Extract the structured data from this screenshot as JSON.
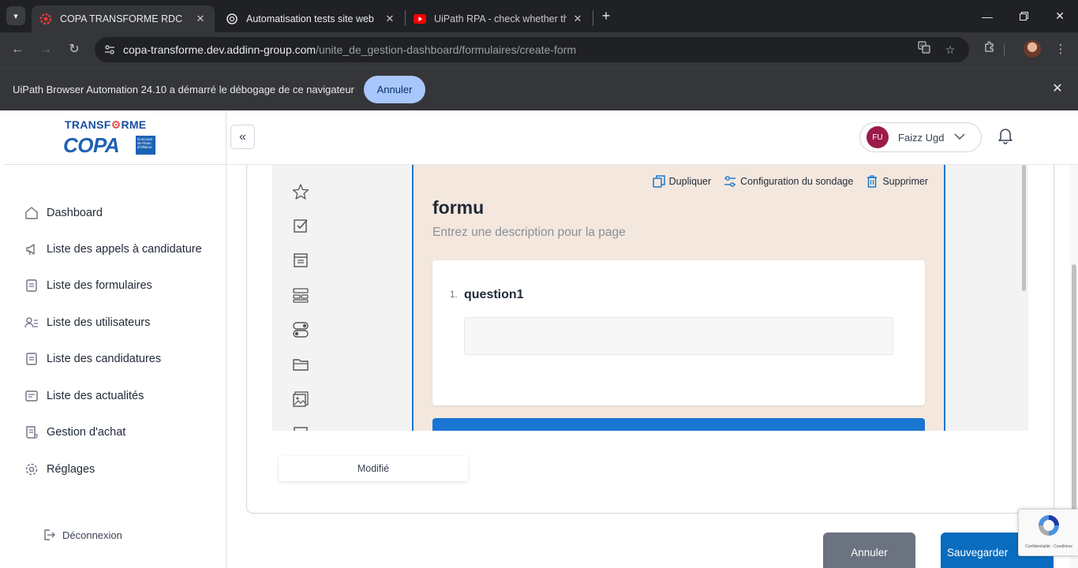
{
  "browser": {
    "tabs": [
      {
        "title": "COPA TRANSFORME RDC",
        "active": true
      },
      {
        "title": "Automatisation tests site web",
        "active": false
      },
      {
        "title": "UiPath RPA - check whether the",
        "active": false
      }
    ],
    "url_host": "copa-transforme.dev.addinn-group.com",
    "url_path": "/unite_de_gestion-dashboard/formulaires/create-form",
    "infobar_message": "UiPath Browser Automation 24.10 a démarré le débogage de ce navigateur",
    "infobar_button": "Annuler"
  },
  "logo": {
    "line1_a": "TRANSF",
    "line1_gear": "⚙",
    "line1_b": "RME",
    "line2": "COPA",
    "tagline": "Concours de Plans d'Affaires"
  },
  "sidebar": {
    "items": [
      {
        "label": "Dashboard",
        "icon": "home-icon"
      },
      {
        "label": "Liste des appels à candidature",
        "icon": "megaphone-icon"
      },
      {
        "label": "Liste des formulaires",
        "icon": "document-icon"
      },
      {
        "label": "Liste des utilisateurs",
        "icon": "users-icon"
      },
      {
        "label": "Liste des candidatures",
        "icon": "document-icon"
      },
      {
        "label": "Liste des actualités",
        "icon": "news-icon"
      },
      {
        "label": "Gestion d'achat",
        "icon": "receipt-icon"
      },
      {
        "label": "Réglages",
        "icon": "gear-icon"
      }
    ],
    "logout_label": "Déconnexion"
  },
  "header": {
    "user_initials": "FU",
    "user_name": "Faizz Ugd"
  },
  "editor": {
    "toolbox_icons": [
      "star-icon",
      "checkbox-icon",
      "comment-icon",
      "multiple-text-icon",
      "toggle-icon",
      "folder-icon",
      "image-icon",
      "panel-icon"
    ],
    "page_actions": {
      "duplicate": "Dupliquer",
      "configure": "Configuration du sondage",
      "delete": "Supprimer"
    },
    "form_title": "formu",
    "form_description": "Entrez une description pour la page",
    "question_number": "1.",
    "question_title": "question1",
    "bottom_tab": "Modifié"
  },
  "footer": {
    "cancel_label": "Annuler",
    "save_label": "Sauvegarder"
  },
  "recaptcha": {
    "text": "Confidentialité - Conditions"
  },
  "colors": {
    "accent": "#1976d2",
    "page_panel_bg": "#f4e8de",
    "avatar": "#9b1b4a",
    "save_button": "#0a6cbf",
    "cancel_button": "#6b7280"
  }
}
